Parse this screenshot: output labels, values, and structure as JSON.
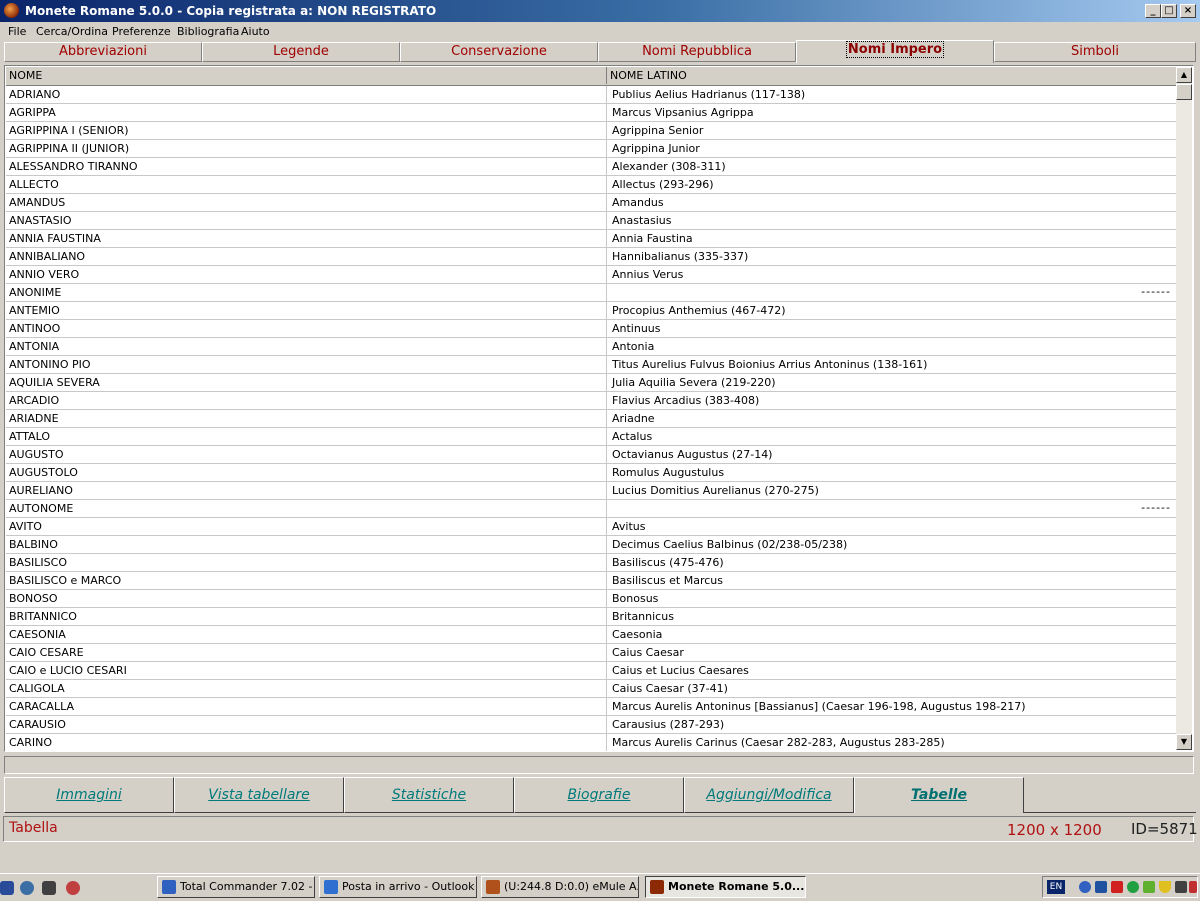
{
  "window": {
    "title": "Monete Romane 5.0.0 - Copia registrata a:  NON REGISTRATO",
    "min_label": "_",
    "max_label": "□",
    "close_label": "×"
  },
  "menu": [
    "File",
    "Cerca/Ordina",
    "Preferenze",
    "Bibliografia",
    "Aiuto"
  ],
  "top_tabs": [
    {
      "label": "Abbreviazioni",
      "active": false
    },
    {
      "label": "Legende",
      "active": false
    },
    {
      "label": "Conservazione",
      "active": false
    },
    {
      "label": "Nomi Repubblica",
      "active": false
    },
    {
      "label": "Nomi Impero",
      "active": true
    },
    {
      "label": "Simboli",
      "active": false
    }
  ],
  "grid": {
    "columns": [
      "NOME",
      "NOME LATINO"
    ],
    "rows": [
      {
        "nome": "ADRIANO",
        "latino": "Publius Aelius Hadrianus (117-138)",
        "extra": ""
      },
      {
        "nome": "AGRIPPA",
        "latino": "Marcus Vipsanius Agrippa",
        "extra": ""
      },
      {
        "nome": "AGRIPPINA I (SENIOR)",
        "latino": "Agrippina Senior",
        "extra": ""
      },
      {
        "nome": "AGRIPPINA II (JUNIOR)",
        "latino": "Agrippina Junior",
        "extra": ""
      },
      {
        "nome": "ALESSANDRO TIRANNO",
        "latino": "Alexander (308-311)",
        "extra": ""
      },
      {
        "nome": "ALLECTO",
        "latino": "Allectus (293-296)",
        "extra": ""
      },
      {
        "nome": "AMANDUS",
        "latino": "Amandus",
        "extra": ""
      },
      {
        "nome": "ANASTASIO",
        "latino": "Anastasius",
        "extra": ""
      },
      {
        "nome": "ANNIA FAUSTINA",
        "latino": "Annia Faustina",
        "extra": ""
      },
      {
        "nome": "ANNIBALIANO",
        "latino": "Hannibalianus (335-337)",
        "extra": ""
      },
      {
        "nome": "ANNIO VERO",
        "latino": "Annius Verus",
        "extra": ""
      },
      {
        "nome": "ANONIME",
        "latino": "",
        "extra": "------"
      },
      {
        "nome": "ANTEMIO",
        "latino": "Procopius Anthemius (467-472)",
        "extra": ""
      },
      {
        "nome": "ANTINOO",
        "latino": "Antinuus",
        "extra": ""
      },
      {
        "nome": "ANTONIA",
        "latino": "Antonia",
        "extra": ""
      },
      {
        "nome": "ANTONINO PIO",
        "latino": "Titus Aurelius Fulvus Boionius Arrius Antoninus (138-161)",
        "extra": ""
      },
      {
        "nome": "AQUILIA SEVERA",
        "latino": "Julia Aquilia Severa (219-220)",
        "extra": ""
      },
      {
        "nome": "ARCADIO",
        "latino": "Flavius Arcadius (383-408)",
        "extra": ""
      },
      {
        "nome": "ARIADNE",
        "latino": "Ariadne",
        "extra": ""
      },
      {
        "nome": "ATTALO",
        "latino": "Actalus",
        "extra": ""
      },
      {
        "nome": "AUGUSTO",
        "latino": "Octavianus Augustus (27-14)",
        "extra": ""
      },
      {
        "nome": "AUGUSTOLO",
        "latino": "Romulus Augustulus",
        "extra": ""
      },
      {
        "nome": "AURELIANO",
        "latino": "Lucius Domitius Aurelianus (270-275)",
        "extra": ""
      },
      {
        "nome": "AUTONOME",
        "latino": "",
        "extra": "------"
      },
      {
        "nome": "AVITO",
        "latino": "Avitus",
        "extra": ""
      },
      {
        "nome": "BALBINO",
        "latino": "Decimus Caelius Balbinus (02/238-05/238)",
        "extra": ""
      },
      {
        "nome": "BASILISCO",
        "latino": "Basiliscus (475-476)",
        "extra": ""
      },
      {
        "nome": "BASILISCO e MARCO",
        "latino": "Basiliscus et Marcus",
        "extra": ""
      },
      {
        "nome": "BONOSO",
        "latino": "Bonosus",
        "extra": ""
      },
      {
        "nome": "BRITANNICO",
        "latino": "Britannicus",
        "extra": ""
      },
      {
        "nome": "CAESONIA",
        "latino": "Caesonia",
        "extra": ""
      },
      {
        "nome": "CAIO CESARE",
        "latino": "Caius Caesar",
        "extra": ""
      },
      {
        "nome": "CAIO e LUCIO CESARI",
        "latino": "Caius et Lucius Caesares",
        "extra": ""
      },
      {
        "nome": "CALIGOLA",
        "latino": "Caius Caesar (37-41)",
        "extra": ""
      },
      {
        "nome": "CARACALLA",
        "latino": "Marcus Aurelis Antoninus [Bassianus] (Caesar 196-198, Augustus 198-217)",
        "extra": ""
      },
      {
        "nome": "CARAUSIO",
        "latino": "Carausius (287-293)",
        "extra": ""
      },
      {
        "nome": "CARINO",
        "latino": "Marcus Aurelis Carinus (Caesar 282-283, Augustus 283-285)",
        "extra": ""
      }
    ]
  },
  "bottom_tabs": [
    {
      "label": "Immagini",
      "active": false
    },
    {
      "label": "Vista tabellare",
      "active": false
    },
    {
      "label": "Statistiche",
      "active": false
    },
    {
      "label": "Biografie",
      "active": false
    },
    {
      "label": "Aggiungi/Modifica",
      "active": false
    },
    {
      "label": "Tabelle",
      "active": true
    }
  ],
  "status": {
    "label": "Tabella",
    "size": "1200 x 1200",
    "id": "ID=5871"
  },
  "taskbar": {
    "tasks": [
      {
        "label": "Total Commander 7.02 - ...",
        "icon": "total-commander-icon",
        "color": "#3060c0",
        "active": false
      },
      {
        "label": "Posta in arrivo - Outlook ...",
        "icon": "outlook-icon",
        "color": "#2f6fd0",
        "active": false
      },
      {
        "label": "(U:244.8 D:0.0) eMule A...",
        "icon": "emule-icon",
        "color": "#b0501a",
        "active": false
      },
      {
        "label": "Monete Romane 5.0....",
        "icon": "coin-icon",
        "color": "#8c2a06",
        "active": true
      }
    ],
    "lang": "EN"
  }
}
